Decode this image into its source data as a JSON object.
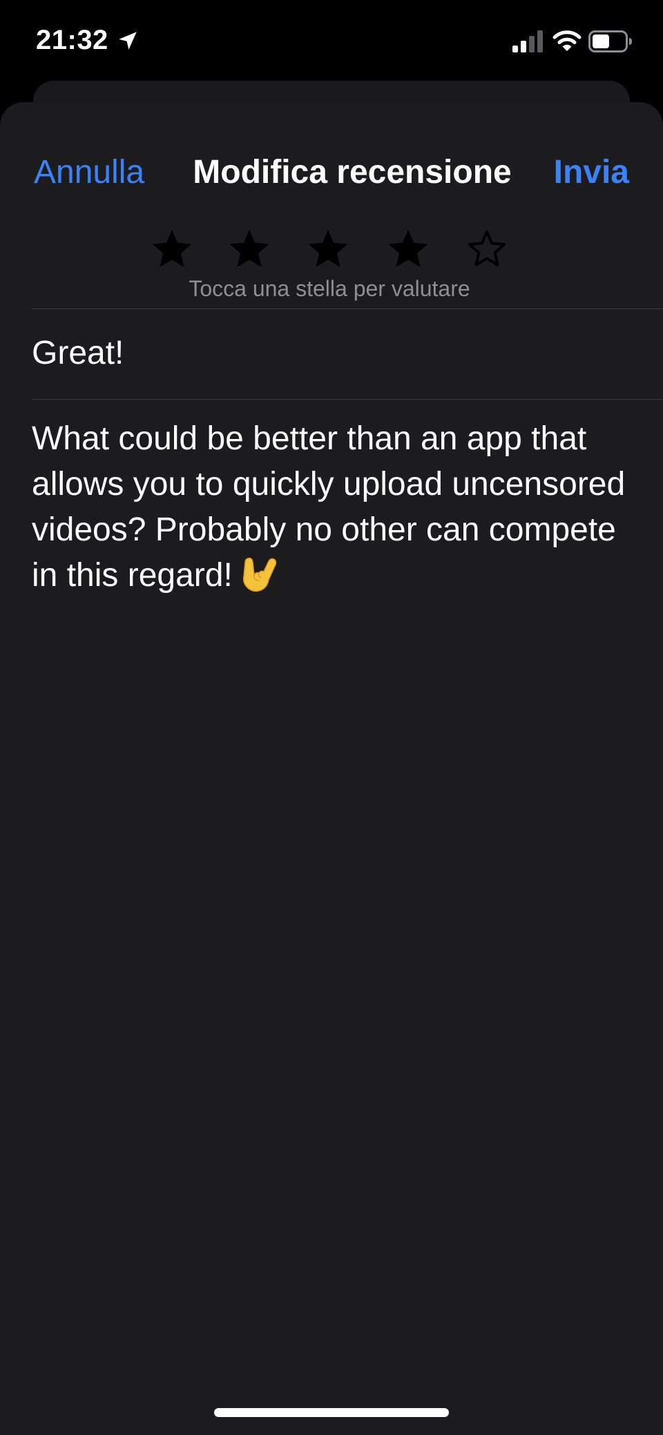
{
  "status_bar": {
    "time": "21:32"
  },
  "nav": {
    "cancel_label": "Annulla",
    "title": "Modifica recensione",
    "send_label": "Invia"
  },
  "rating": {
    "value": 4,
    "max": 5,
    "hint": "Tocca una stella per valutare"
  },
  "review": {
    "title": "Great!",
    "body": "What could be better than an app that allows you to quickly upload uncensored videos? Probably no other can compete in this regard!"
  },
  "icons": {
    "status": [
      "location-arrow-icon",
      "signal-icon",
      "wifi-icon",
      "battery-icon"
    ],
    "emoji": "sign-of-the-horns-icon"
  },
  "colors": {
    "accent": "#3b82f6",
    "sheet_background": "#1c1c1e",
    "hint_text": "#8e8e93",
    "star_fill": "#000000"
  }
}
